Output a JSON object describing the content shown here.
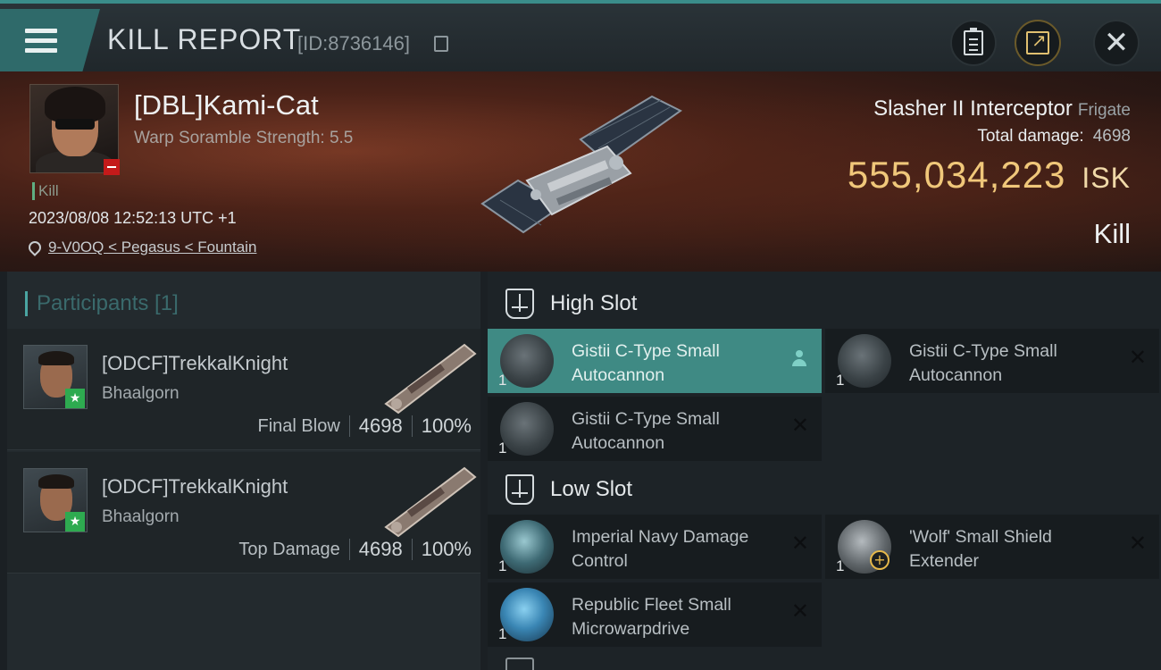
{
  "header": {
    "title": "KILL REPORT",
    "report_id": "[ID:8736146]"
  },
  "victim": {
    "name": "[DBL]Kami-Cat",
    "stat": "Warp Soramble Strength: 5.5",
    "kill_tag": "Kill",
    "datetime": "2023/08/08 12:52:13 UTC +1",
    "location": "9-V0OQ < Pegasus < Fountain",
    "ship_name": "Slasher II Interceptor",
    "ship_class": "Frigate",
    "total_damage_label": "Total damage:",
    "total_damage_value": "4698",
    "isk_value": "555,034,223",
    "isk_unit": "ISK",
    "result": "Kill"
  },
  "participants": {
    "title": "Participants [1]",
    "items": [
      {
        "name": "[ODCF]TrekkalKnight",
        "ship": "Bhaalgorn",
        "role": "Final Blow",
        "damage": "4698",
        "percent": "100%"
      },
      {
        "name": "[ODCF]TrekkalKnight",
        "ship": "Bhaalgorn",
        "role": "Top Damage",
        "damage": "4698",
        "percent": "100%"
      }
    ]
  },
  "slots": {
    "high": {
      "title": "High Slot",
      "modules": [
        {
          "name": "Gistii C-Type Small Autocannon",
          "qty": "1",
          "state": "dropped"
        },
        {
          "name": "Gistii C-Type Small Autocannon",
          "qty": "1",
          "state": "destroyed"
        },
        {
          "name": "Gistii C-Type Small Autocannon",
          "qty": "1",
          "state": "destroyed"
        }
      ]
    },
    "low": {
      "title": "Low Slot",
      "modules": [
        {
          "name": "Imperial Navy Damage Control",
          "qty": "1",
          "state": "destroyed"
        },
        {
          "name": "'Wolf' Small Shield Extender",
          "qty": "1",
          "state": "destroyed"
        },
        {
          "name": "Republic Fleet Small Microwarpdrive",
          "qty": "1",
          "state": "destroyed"
        }
      ]
    }
  },
  "colors": {
    "accent": "#3f8a84",
    "isk": "#f0c77a",
    "kill_badge": "#c41a1a",
    "participant_badge": "#2eaa50"
  },
  "icons": [
    "menu-icon",
    "copy-icon",
    "clipboard-icon",
    "share-icon",
    "close-icon",
    "location-pin-icon",
    "high-slot-icon",
    "low-slot-icon",
    "person-icon",
    "remove-icon",
    "star-icon",
    "plus-icon"
  ]
}
